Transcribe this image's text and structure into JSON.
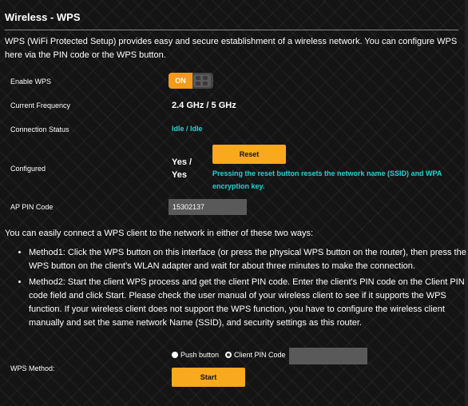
{
  "page": {
    "title": "Wireless - WPS",
    "description": "WPS (WiFi Protected Setup) provides easy and secure establishment of a wireless network. You can configure WPS here via the PIN code or the WPS button."
  },
  "settings": {
    "enable_wps": {
      "label": "Enable WPS",
      "state_label": "ON",
      "enabled": true
    },
    "frequency": {
      "label": "Current Frequency",
      "value": "2.4 GHz / 5 GHz"
    },
    "connection_status": {
      "label": "Connection Status",
      "value": "Idle / Idle"
    },
    "configured": {
      "label": "Configured",
      "value_line1": "Yes /",
      "value_line2": "Yes",
      "reset_label": "Reset",
      "reset_note_line1": "Pressing the reset button resets the network name (SSID) and WPA",
      "reset_note_line2": "encryption key."
    },
    "ap_pin": {
      "label": "AP PIN Code",
      "value": "15302137"
    }
  },
  "instructions": {
    "intro": "You can easily connect a WPS client to the network in either of these two ways:",
    "methods": [
      "Method1: Click the WPS button on this interface (or press the physical WPS button on the router), then press the WPS button on the client's WLAN adapter and wait for about three minutes to make the connection.",
      "Method2: Start the client WPS process and get the client PIN code. Enter the client's PIN code on the Client PIN code field and click Start. Please check the user manual of your wireless client to see if it supports the WPS function. If your wireless client does not support the WPS function, you have to configure the wireless client manually and set the same network Name (SSID), and security settings as this router."
    ]
  },
  "wps_method": {
    "label": "WPS Method:",
    "options": [
      {
        "label": "Push button",
        "selected": false
      },
      {
        "label": "Client PIN Code",
        "selected": true
      }
    ],
    "client_pin_value": "",
    "start_label": "Start"
  },
  "colors": {
    "accent": "#f9a91d",
    "status": "#27d3d3",
    "background": "#141414"
  }
}
